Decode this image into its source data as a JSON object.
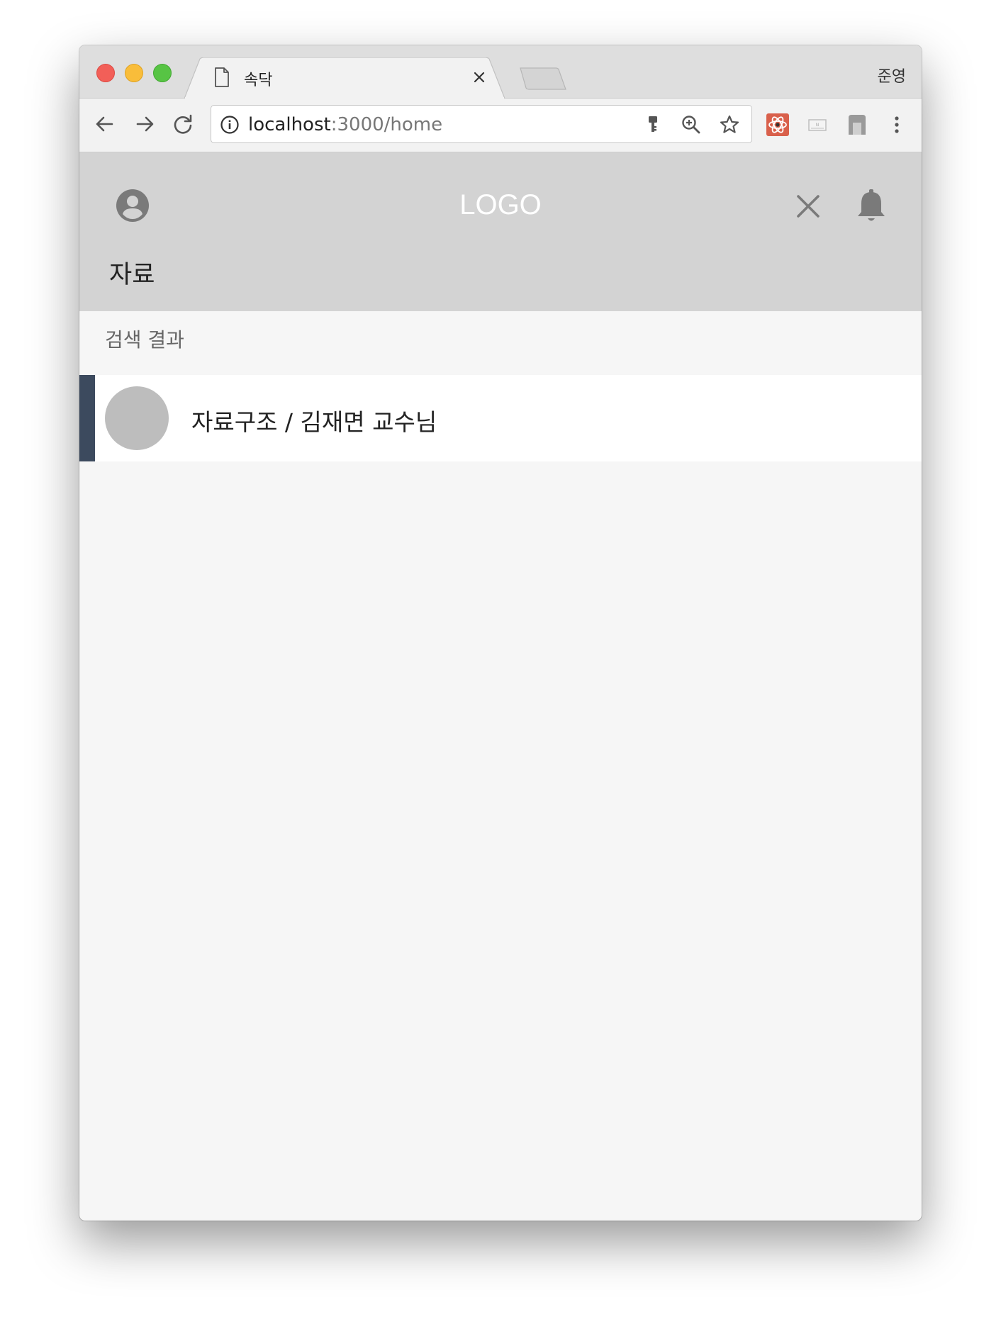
{
  "browser": {
    "tab_title": "속닥",
    "profile_name": "준영",
    "url_host": "localhost",
    "url_path": ":3000/home"
  },
  "header": {
    "logo": "LOGO",
    "section_title": "자료"
  },
  "content": {
    "results_label": "검색 결과",
    "results": [
      {
        "title": "자료구조 / 김재면 교수님"
      }
    ]
  },
  "colors": {
    "header_bg": "#d3d3d3",
    "accent": "#3c4a5e",
    "page_bg": "#f6f6f6"
  },
  "icons": {
    "header_left": "account-circle-icon",
    "header_right": [
      "close-icon",
      "bell-icon"
    ],
    "toolbar": [
      "back-arrow-icon",
      "forward-arrow-icon",
      "reload-icon",
      "info-icon",
      "key-icon",
      "zoom-icon",
      "star-icon",
      "react-devtools-icon",
      "extension-icon",
      "extension-icon",
      "menu-dots-icon"
    ]
  }
}
